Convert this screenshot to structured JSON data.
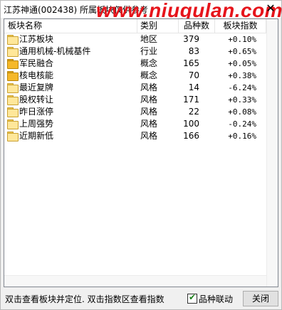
{
  "window": {
    "title": "江苏神通(002438)  所属板块仅供参考",
    "watermark": "www.niugulan.com"
  },
  "table": {
    "headers": {
      "name": "板块名称",
      "type": "类别",
      "count": "品种数",
      "index": "板块指数"
    },
    "rows": [
      {
        "name": "江苏板块",
        "type": "地区",
        "count": "379",
        "index": "+0.10%",
        "icon": "folder-open-icon"
      },
      {
        "name": "通用机械-机械基件",
        "type": "行业",
        "count": "83",
        "index": "+0.65%",
        "icon": "folder-open-icon"
      },
      {
        "name": "军民融合",
        "type": "概念",
        "count": "165",
        "index": "+0.05%",
        "icon": "folder-closed-icon"
      },
      {
        "name": "核电核能",
        "type": "概念",
        "count": "70",
        "index": "+0.38%",
        "icon": "folder-closed-icon"
      },
      {
        "name": "最近复牌",
        "type": "风格",
        "count": "14",
        "index": "-6.24%",
        "icon": "folder-open-icon"
      },
      {
        "name": "股权转让",
        "type": "风格",
        "count": "171",
        "index": "+0.33%",
        "icon": "folder-open-icon"
      },
      {
        "name": "昨日涨停",
        "type": "风格",
        "count": "22",
        "index": "+0.08%",
        "icon": "folder-open-icon"
      },
      {
        "name": "上周强势",
        "type": "风格",
        "count": "100",
        "index": "-0.24%",
        "icon": "folder-open-icon"
      },
      {
        "name": "近期新低",
        "type": "风格",
        "count": "166",
        "index": "+0.16%",
        "icon": "folder-open-icon"
      }
    ]
  },
  "footer": {
    "status_text": "双击查看板块并定位. 双击指数区查看指数",
    "checkbox_label": "品种联动",
    "checkbox_checked": true,
    "close_label": "关闭"
  },
  "colors": {
    "watermark": "#e6141b",
    "folder_open": "#ffe79a",
    "folder_closed": "#f5b829"
  }
}
